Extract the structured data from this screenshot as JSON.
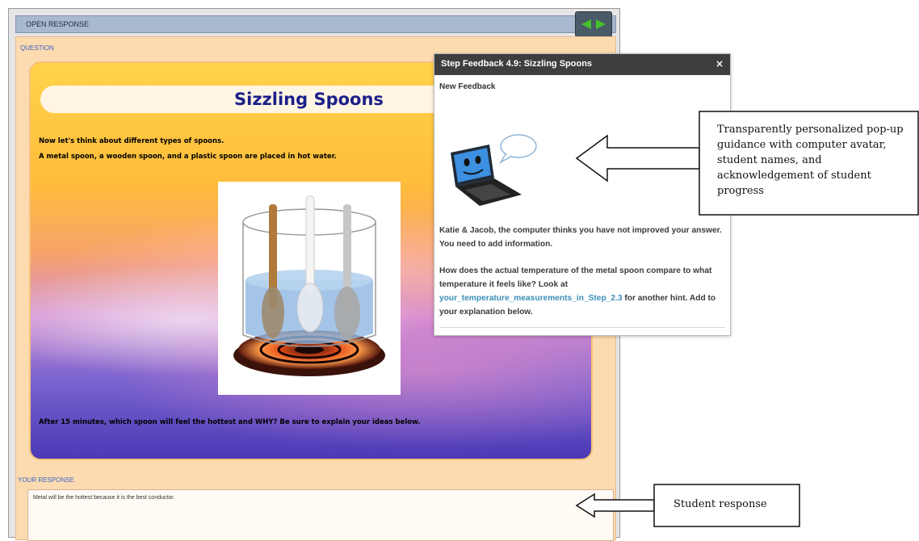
{
  "window": {
    "header_title": "OPEN RESPONSE",
    "nav": {
      "prev_icon": "left-arrow-icon",
      "next_icon": "right-arrow-icon",
      "accent": "#46c02e"
    }
  },
  "question": {
    "section_label": "QUESTION",
    "title": "Sizzling Spoons",
    "line1": "Now let's think about different types of spoons.",
    "line2": "A metal spoon, a wooden spoon, and a plastic spoon are placed in hot water.",
    "prompt": "After 15 minutes, which spoon will feel the hottest and WHY?  Be sure to explain your ideas below."
  },
  "response": {
    "section_label": "YOUR RESPONSE",
    "text": "Metal will be the hottest because it is the best conductor."
  },
  "popup": {
    "title": "Step Feedback 4.9: Sizzling Spoons",
    "close_glyph": "×",
    "subtitle": "New Feedback",
    "para1": "Katie & Jacob, the computer thinks you have not improved your answer. You need to add information.",
    "para2_before": "How does the actual temperature of the metal spoon compare to what temperature it feels like? Look at ",
    "para2_link": "your_temperature_measurements_in_Step_2.3",
    "para2_after": " for another hint. Add to your explanation below.",
    "avatar_icon": "laptop-avatar-icon"
  },
  "annotations": {
    "callout1": "Transparently personalized pop-up guidance with computer avatar, student names, and acknowledgement of student progress",
    "callout2": "Student response"
  }
}
